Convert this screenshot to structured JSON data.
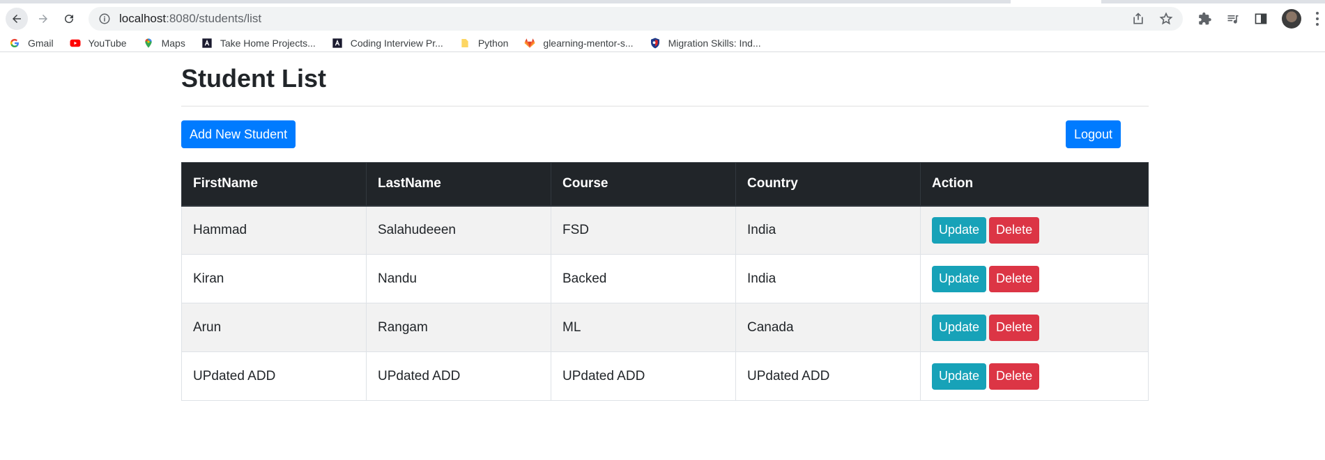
{
  "browser": {
    "url_host": "localhost",
    "url_path": ":8080/students/list",
    "bookmarks": [
      {
        "label": "Gmail",
        "icon": "google-icon"
      },
      {
        "label": "YouTube",
        "icon": "youtube-icon"
      },
      {
        "label": "Maps",
        "icon": "maps-icon"
      },
      {
        "label": "Take Home Projects...",
        "icon": "code-icon"
      },
      {
        "label": "Coding Interview Pr...",
        "icon": "code-icon"
      },
      {
        "label": "Python",
        "icon": "folder-icon"
      },
      {
        "label": "glearning-mentor-s...",
        "icon": "gitlab-icon"
      },
      {
        "label": "Migration Skills: Ind...",
        "icon": "shield-icon"
      }
    ]
  },
  "page": {
    "title": "Student List",
    "add_button": "Add New Student",
    "logout_button": "Logout"
  },
  "table": {
    "headers": [
      "FirstName",
      "LastName",
      "Course",
      "Country",
      "Action"
    ],
    "rows": [
      {
        "first": "Hammad",
        "last": "Salahudeeen",
        "course": "FSD",
        "country": "India"
      },
      {
        "first": "Kiran",
        "last": "Nandu",
        "course": "Backed",
        "country": "India"
      },
      {
        "first": "Arun",
        "last": "Rangam",
        "course": "ML",
        "country": "Canada"
      },
      {
        "first": "UPdated ADD",
        "last": "UPdated ADD",
        "course": "UPdated ADD",
        "country": "UPdated ADD"
      }
    ],
    "update_label": "Update",
    "delete_label": "Delete"
  },
  "colors": {
    "primary": "#007bff",
    "info": "#17a2b8",
    "danger": "#dc3545",
    "header_bg": "#212529"
  }
}
